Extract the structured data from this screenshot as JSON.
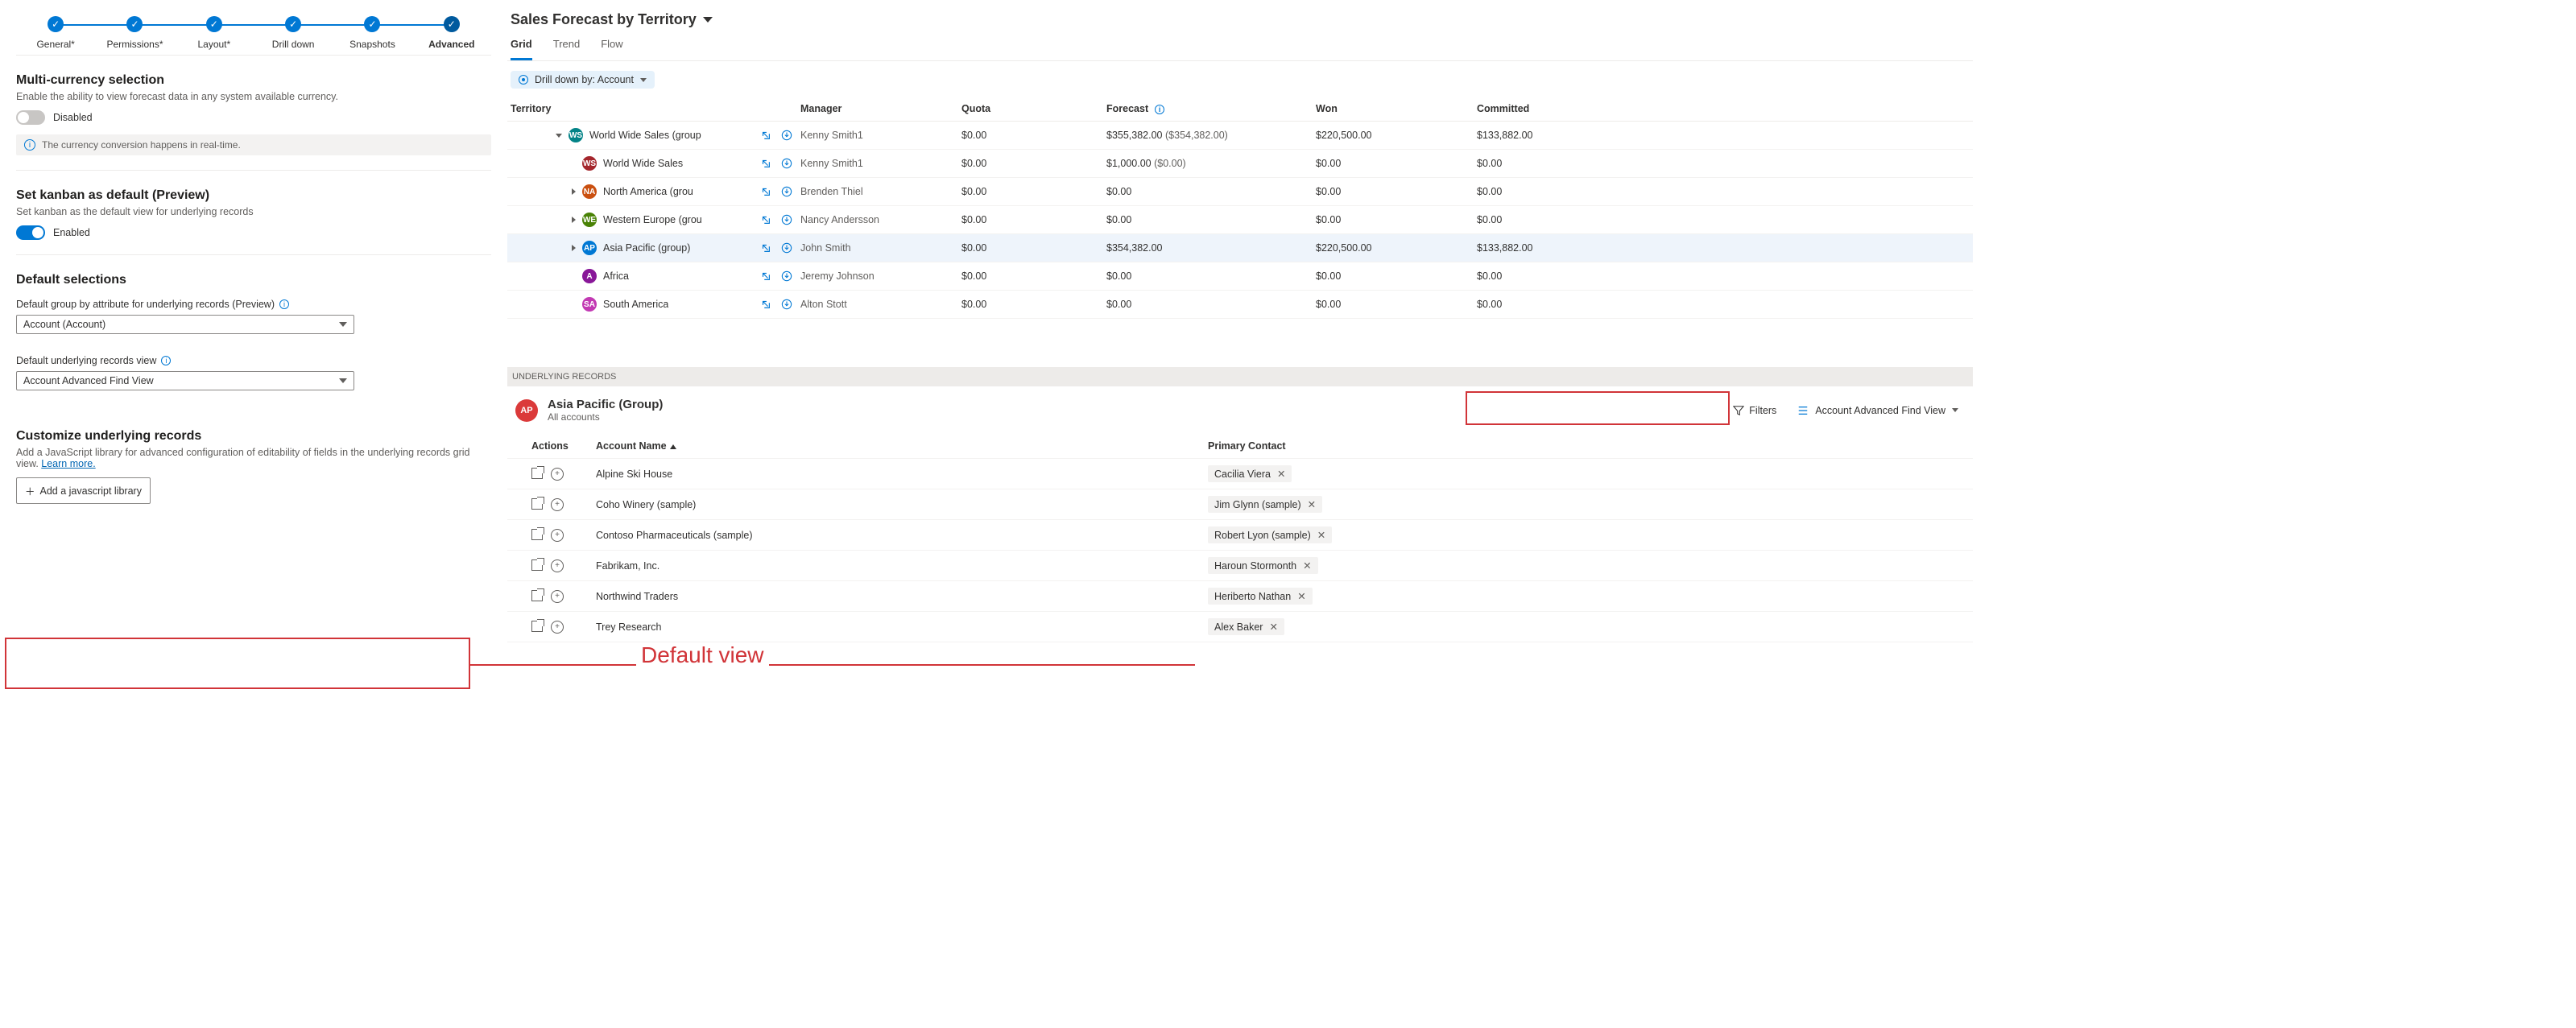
{
  "stepper": {
    "steps": [
      {
        "label": "General*"
      },
      {
        "label": "Permissions*"
      },
      {
        "label": "Layout*"
      },
      {
        "label": "Drill down"
      },
      {
        "label": "Snapshots"
      },
      {
        "label": "Advanced"
      }
    ]
  },
  "multi_currency": {
    "title": "Multi-currency selection",
    "desc": "Enable the ability to view forecast data in any system available currency.",
    "toggle_label": "Disabled",
    "info": "The currency conversion happens in real-time."
  },
  "kanban": {
    "title": "Set kanban as default (Preview)",
    "desc": "Set kanban as the default view for underlying records",
    "toggle_label": "Enabled"
  },
  "defaults": {
    "title": "Default selections",
    "group_label": "Default group by attribute for underlying records (Preview)",
    "group_value": "Account (Account)",
    "view_label": "Default underlying records view",
    "view_value": "Account Advanced Find View"
  },
  "customize": {
    "title": "Customize underlying records",
    "desc_pre": "Add a JavaScript library for advanced configuration of editability of fields in the underlying records grid view. ",
    "learn_more": "Learn more.",
    "button": "Add a javascript library"
  },
  "annotation": "Default view",
  "forecast": {
    "title": "Sales Forecast by Territory",
    "tabs": {
      "grid": "Grid",
      "trend": "Trend",
      "flow": "Flow"
    },
    "drilldown": "Drill down by: Account",
    "columns": {
      "territory": "Territory",
      "manager": "Manager",
      "quota": "Quota",
      "forecast": "Forecast",
      "won": "Won",
      "committed": "Committed"
    },
    "rows": [
      {
        "indent": 1,
        "expand": "down",
        "avatarBg": "#038387",
        "initials": "WS",
        "name": "World Wide Sales (group",
        "manager": "Kenny Smith1",
        "quota": "$0.00",
        "forecast": "$355,382.00",
        "forecast_sub": "($354,382.00)",
        "won": "$220,500.00",
        "committed": "$133,882.00"
      },
      {
        "indent": 2,
        "expand": "",
        "avatarBg": "#a4262c",
        "initials": "WS",
        "name": "World Wide Sales",
        "manager": "Kenny Smith1",
        "quota": "$0.00",
        "forecast": "$1,000.00",
        "forecast_sub": "($0.00)",
        "won": "$0.00",
        "committed": "$0.00"
      },
      {
        "indent": 2,
        "expand": "right",
        "avatarBg": "#ca5010",
        "initials": "NA",
        "name": "North America (grou",
        "manager": "Brenden Thiel",
        "quota": "$0.00",
        "forecast": "$0.00",
        "forecast_sub": "",
        "won": "$0.00",
        "committed": "$0.00"
      },
      {
        "indent": 2,
        "expand": "right",
        "avatarBg": "#498205",
        "initials": "WE",
        "name": "Western Europe (grou",
        "manager": "Nancy Andersson",
        "quota": "$0.00",
        "forecast": "$0.00",
        "forecast_sub": "",
        "won": "$0.00",
        "committed": "$0.00"
      },
      {
        "indent": 2,
        "expand": "right",
        "highlight": true,
        "avatarBg": "#0078d4",
        "initials": "AP",
        "name": "Asia Pacific (group)",
        "manager": "John Smith",
        "quota": "$0.00",
        "forecast": "$354,382.00",
        "forecast_sub": "",
        "won": "$220,500.00",
        "committed": "$133,882.00"
      },
      {
        "indent": 2,
        "expand": "",
        "avatarBg": "#881798",
        "initials": "A",
        "name": "Africa",
        "manager": "Jeremy Johnson",
        "quota": "$0.00",
        "forecast": "$0.00",
        "forecast_sub": "",
        "won": "$0.00",
        "committed": "$0.00"
      },
      {
        "indent": 2,
        "expand": "",
        "avatarBg": "#c239b3",
        "initials": "SA",
        "name": "South America",
        "manager": "Alton Stott",
        "quota": "$0.00",
        "forecast": "$0.00",
        "forecast_sub": "",
        "won": "$0.00",
        "committed": "$0.00"
      }
    ]
  },
  "underlying": {
    "header": "UNDERLYING RECORDS",
    "avatar": "AP",
    "title": "Asia Pacific (Group)",
    "sub": "All accounts",
    "filters": "Filters",
    "view": "Account Advanced Find View",
    "columns": {
      "actions": "Actions",
      "account": "Account Name",
      "contact": "Primary Contact"
    },
    "rows": [
      {
        "account": "Alpine Ski House",
        "contact": "Cacilia Viera"
      },
      {
        "account": "Coho Winery (sample)",
        "contact": "Jim Glynn (sample)"
      },
      {
        "account": "Contoso Pharmaceuticals (sample)",
        "contact": "Robert Lyon (sample)"
      },
      {
        "account": "Fabrikam, Inc.",
        "contact": "Haroun Stormonth"
      },
      {
        "account": "Northwind Traders",
        "contact": "Heriberto Nathan"
      },
      {
        "account": "Trey Research",
        "contact": "Alex Baker"
      }
    ]
  }
}
